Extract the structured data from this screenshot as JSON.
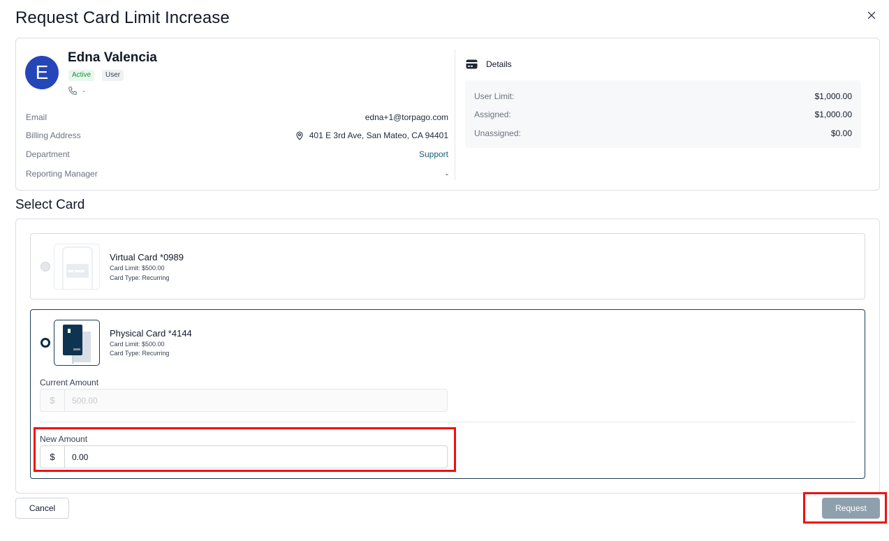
{
  "modal": {
    "title": "Request Card Limit Increase",
    "close_icon": "close-icon"
  },
  "user": {
    "initial": "E",
    "name": "Edna Valencia",
    "status": "Active",
    "role": "User",
    "phone": "-",
    "fields": {
      "email_label": "Email",
      "email_value": "edna+1@torpago.com",
      "billing_label": "Billing Address",
      "billing_value": "401 E 3rd Ave, San Mateo, CA 94401",
      "department_label": "Department",
      "department_value": "Support",
      "manager_label": "Reporting Manager",
      "manager_value": "-"
    }
  },
  "details": {
    "heading": "Details",
    "icon": "credit-card-icon",
    "user_limit_label": "User Limit:",
    "user_limit_value": "$1,000.00",
    "assigned_label": "Assigned:",
    "assigned_value": "$1,000.00",
    "unassigned_label": "Unassigned:",
    "unassigned_value": "$0.00"
  },
  "select_card": {
    "title": "Select Card",
    "cards": [
      {
        "name": "Virtual Card *0989",
        "limit": "Card Limit: $500.00",
        "type": "Card Type: Recurring",
        "selected": false
      },
      {
        "name": "Physical Card *4144",
        "limit": "Card Limit: $500.00",
        "type": "Card Type: Recurring",
        "selected": true
      }
    ],
    "current_amount_label": "Current Amount",
    "current_amount_prefix": "$",
    "current_amount_value": "500.00",
    "new_amount_label": "New Amount",
    "new_amount_prefix": "$",
    "new_amount_value": "0.00"
  },
  "actions": {
    "cancel_label": "Cancel",
    "request_label": "Request"
  },
  "colors": {
    "avatar": "#2546b8",
    "accent_dark": "#0d2a44",
    "link": "#1a5f73",
    "request_disabled": "#8fa0ad",
    "highlight": "#ee1111"
  }
}
